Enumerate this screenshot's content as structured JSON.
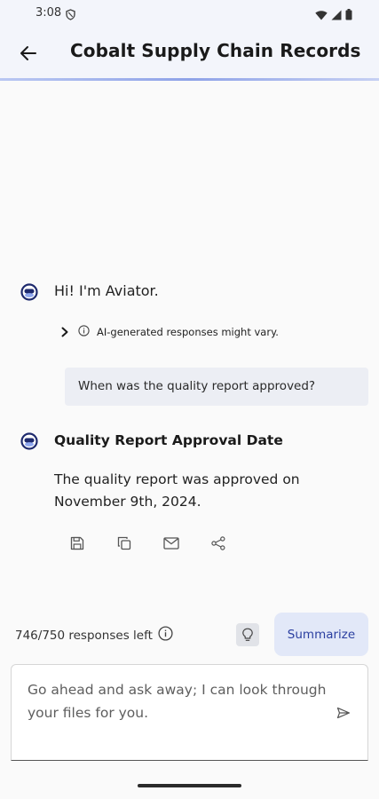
{
  "status_bar": {
    "time": "3:08"
  },
  "header": {
    "title": "Cobalt Supply Chain Records"
  },
  "chat": {
    "greeting": "Hi! I'm Aviator.",
    "disclaimer": "AI-generated responses might vary.",
    "user_message": "When was the quality report approved?",
    "answer_title": "Quality Report Approval Date",
    "answer_text": "The quality report was approved on November 9th, 2024."
  },
  "footer": {
    "quota": "746/750 responses left",
    "summarize_label": "Summarize",
    "input_placeholder": "Go ahead and ask away; I can look through your files for you."
  },
  "icons": {
    "back": "arrow-left-icon",
    "avatar": "aviator-bot-icon",
    "save": "save-icon",
    "copy": "copy-icon",
    "email": "mail-icon",
    "share": "share-icon",
    "info": "info-icon",
    "hint": "lightbulb-icon",
    "send": "send-icon"
  },
  "colors": {
    "accent": "#2b3fa0",
    "summarize_bg": "#e2e8f8",
    "bubble_bg": "#eceef4"
  }
}
